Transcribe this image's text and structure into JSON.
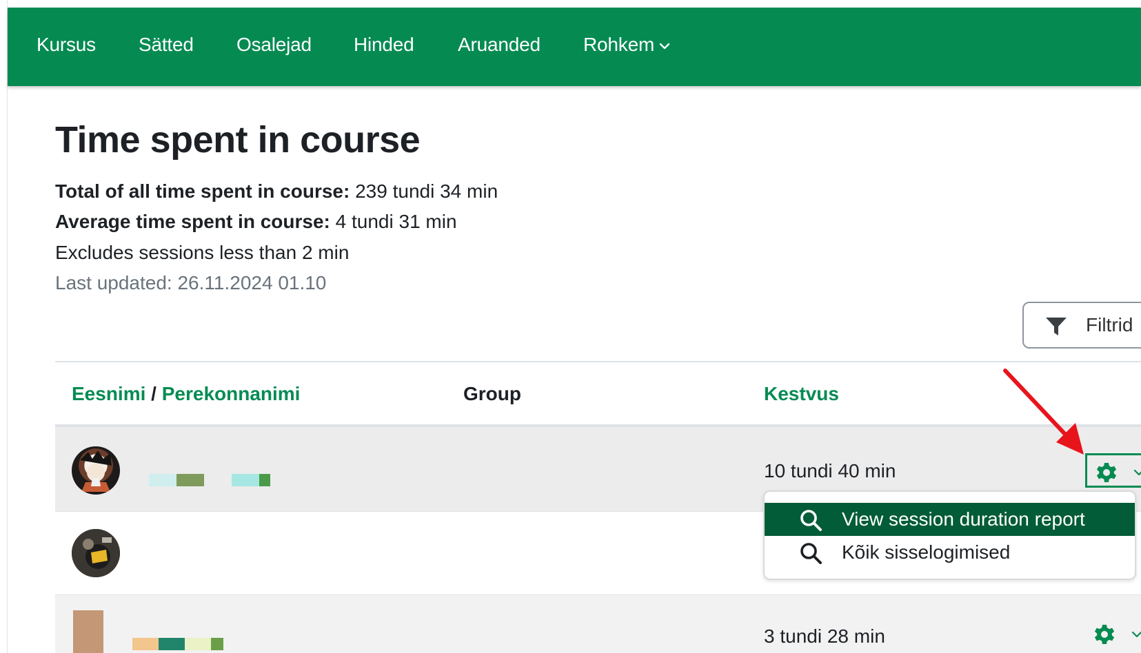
{
  "nav": {
    "items": [
      {
        "label": "Kursus"
      },
      {
        "label": "Sätted"
      },
      {
        "label": "Osalejad"
      },
      {
        "label": "Hinded"
      },
      {
        "label": "Aruanded"
      },
      {
        "label": "Rohkem"
      }
    ]
  },
  "page": {
    "title": "Time spent in course",
    "total_label": "Total of all time spent in course:",
    "total_value": "239 tundi 34 min",
    "average_label": "Average time spent in course:",
    "average_value": "4 tundi 31 min",
    "excludes_note": "Excludes sessions less than 2 min",
    "last_updated": "Last updated: 26.11.2024 01.10"
  },
  "filters": {
    "label": "Filtrid"
  },
  "table": {
    "headers": {
      "firstname": "Eesnimi",
      "separator": "/",
      "lastname": "Perekonnanimi",
      "group": "Group",
      "duration": "Kestvus"
    },
    "rows": [
      {
        "duration": "10 tundi 40 min"
      },
      {
        "duration": ""
      },
      {
        "duration": "3 tundi 28 min"
      }
    ]
  },
  "action_menu": {
    "items": [
      {
        "label": "View session duration report",
        "icon": "search-icon"
      },
      {
        "label": "Kõik sisselogimised",
        "icon": "search-icon"
      }
    ]
  },
  "colors": {
    "brand": "#058b52",
    "brand_dark": "#015c37",
    "annotation_arrow": "#e8141c"
  }
}
